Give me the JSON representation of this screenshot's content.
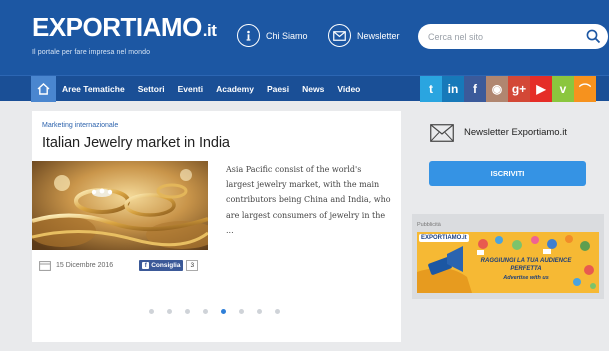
{
  "header": {
    "logo_main": "EXPORTIAMO",
    "logo_tld": "it",
    "tagline": "Il portale per fare impresa nel mondo",
    "links": [
      {
        "label": "Chi Siamo",
        "icon": "info-icon"
      },
      {
        "label": "Newsletter",
        "icon": "envelope-icon"
      }
    ],
    "search_placeholder": "Cerca nel sito"
  },
  "nav": {
    "home_icon": "home-icon",
    "items": [
      "Aree Tematiche",
      "Settori",
      "Eventi",
      "Academy",
      "Paesi",
      "News",
      "Video"
    ]
  },
  "socials": [
    {
      "name": "twitter-icon",
      "glyph": "t",
      "color": "#2aa5e0"
    },
    {
      "name": "linkedin-icon",
      "glyph": "in",
      "color": "#1779b9"
    },
    {
      "name": "facebook-icon",
      "glyph": "f",
      "color": "#3b5a9a"
    },
    {
      "name": "instagram-icon",
      "glyph": "◉",
      "color": "#b08670"
    },
    {
      "name": "googleplus-icon",
      "glyph": "g+",
      "color": "#d34836"
    },
    {
      "name": "youtube-icon",
      "glyph": "▶",
      "color": "#e52d27"
    },
    {
      "name": "vimeo-icon",
      "glyph": "v",
      "color": "#8bc63e"
    },
    {
      "name": "rss-icon",
      "glyph": "⌒",
      "color": "#f6921e"
    }
  ],
  "article": {
    "category": "Marketing internazionale",
    "title": "Italian Jewelry market in India",
    "excerpt": "Asia Pacific consist of the world's largest jewelry market, with the main contributors being China and India, who are largest consumers of jewelry in the ...",
    "date": "15 Dicembre 2016",
    "fb_label": "Consiglia",
    "fb_count": "3",
    "slide_total": 8,
    "slide_active": 5
  },
  "newsletter": {
    "title": "Newsletter Exportiamo.it",
    "button": "ISCRIVITI"
  },
  "ad": {
    "label": "Pubblicità",
    "logo": "EXPORTIAMO.it",
    "headline": "RAGGIUNGI LA TUA AUDIENCE PERFETTA",
    "subline": "Advertise with us"
  }
}
